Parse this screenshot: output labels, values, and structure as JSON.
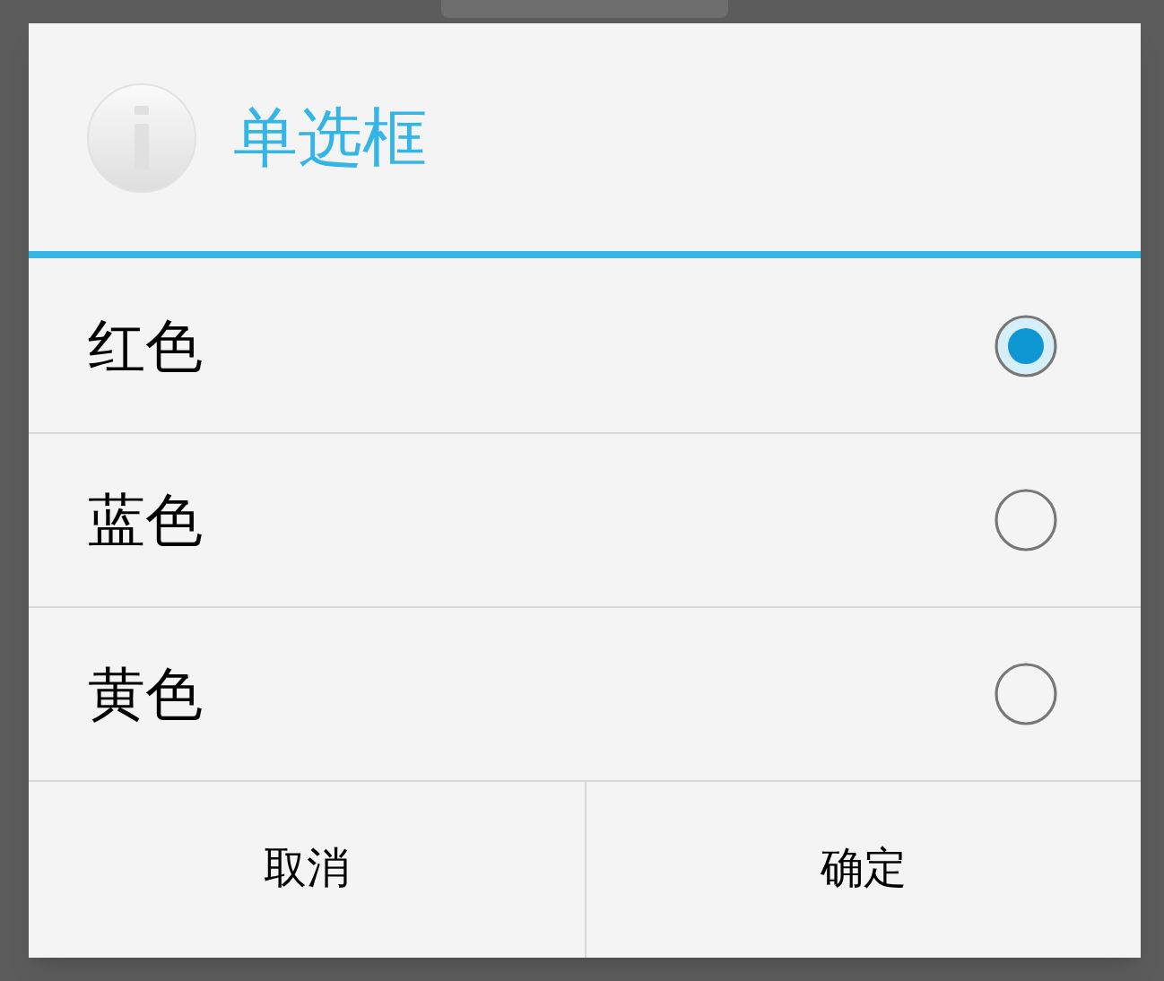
{
  "dialog": {
    "title": "单选框"
  },
  "options": [
    {
      "label": "红色",
      "selected": true
    },
    {
      "label": "蓝色",
      "selected": false
    },
    {
      "label": "黄色",
      "selected": false
    }
  ],
  "buttons": [
    "取消",
    "确定"
  ]
}
